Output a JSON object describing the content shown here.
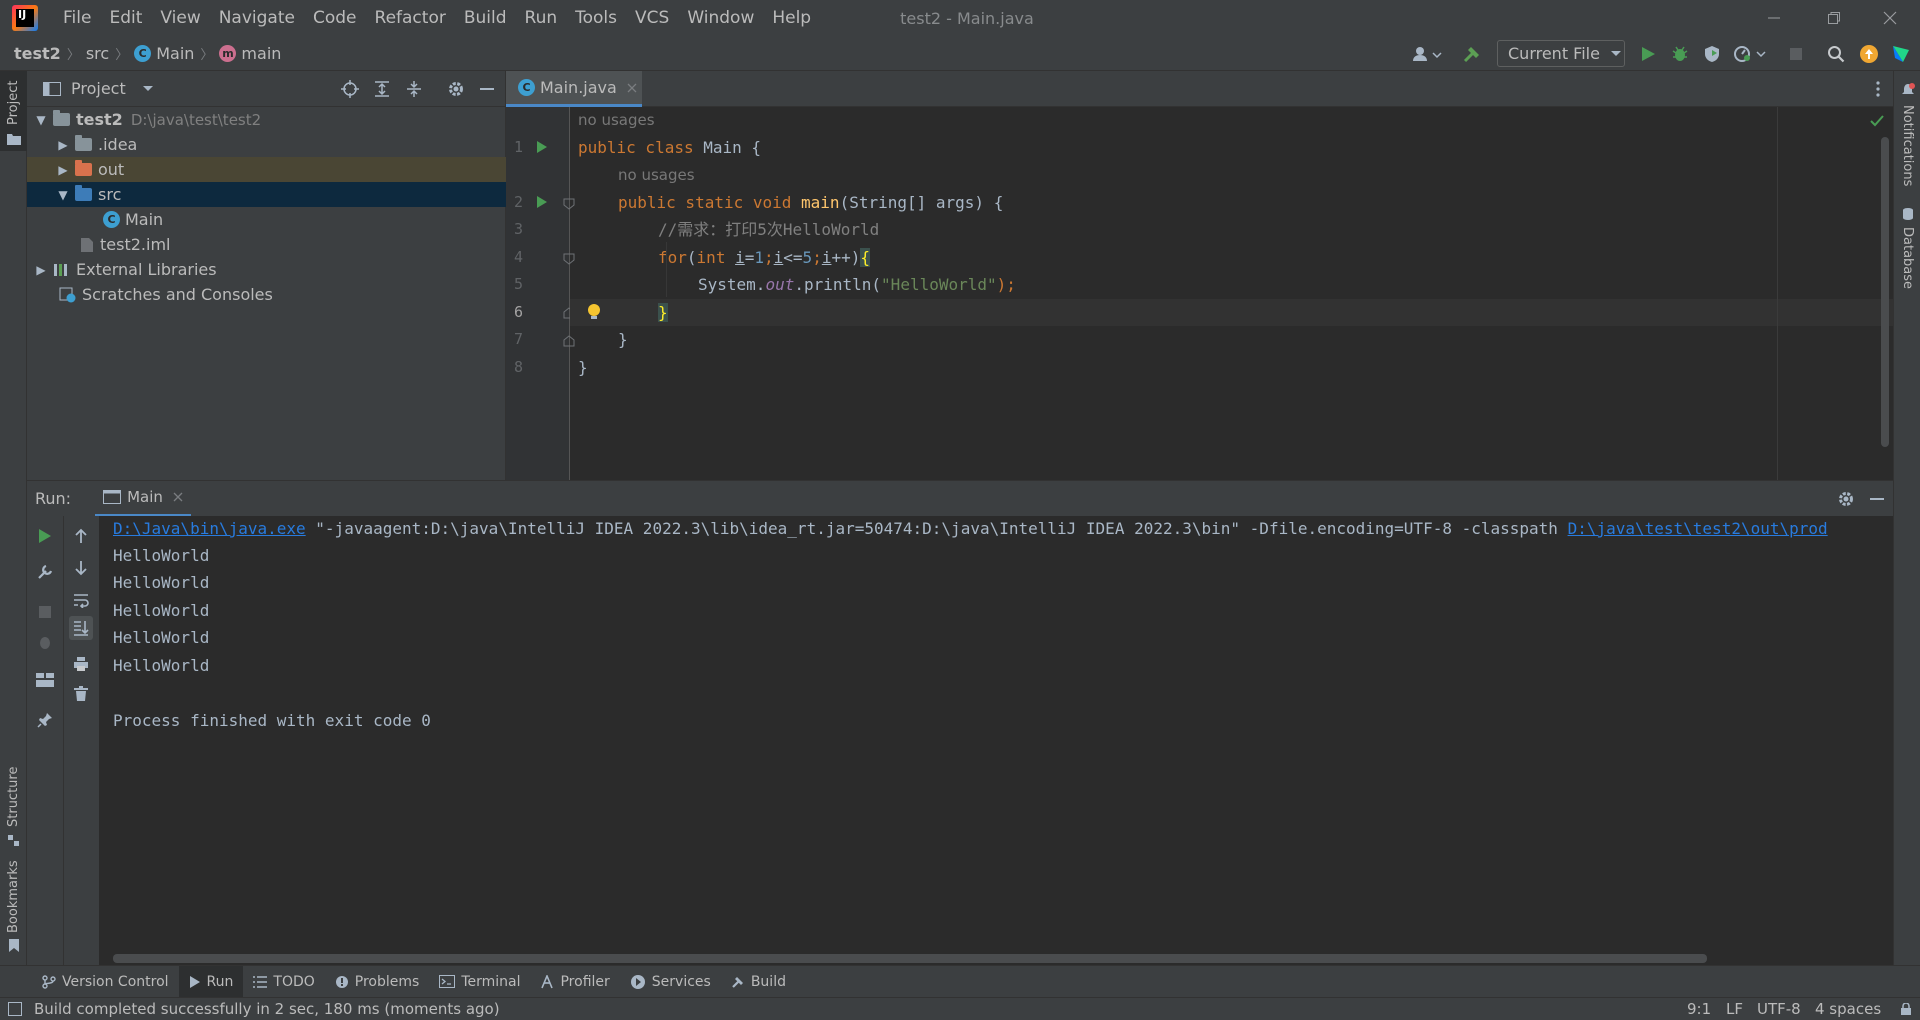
{
  "window": {
    "title": "test2 - Main.java",
    "menu": [
      "File",
      "Edit",
      "View",
      "Navigate",
      "Code",
      "Refactor",
      "Build",
      "Run",
      "Tools",
      "VCS",
      "Window",
      "Help"
    ]
  },
  "navbar": {
    "breadcrumb": [
      "test2",
      "src",
      "Main",
      "main"
    ],
    "run_config": "Current File"
  },
  "project": {
    "title": "Project",
    "tree": [
      {
        "label": "test2",
        "path": "D:\\java\\test\\test2"
      },
      {
        "label": ".idea"
      },
      {
        "label": "out"
      },
      {
        "label": "src"
      },
      {
        "label": "Main"
      },
      {
        "label": "test2.iml"
      },
      {
        "label": "External Libraries"
      },
      {
        "label": "Scratches and Consoles"
      }
    ]
  },
  "editor": {
    "tab": "Main.java",
    "hint": "no usages",
    "line_numbers": [
      "1",
      "2",
      "3",
      "4",
      "5",
      "6",
      "7",
      "8"
    ],
    "code": {
      "l1_kw": "public class ",
      "l1_name": "Main {",
      "l2_kw": "public static void ",
      "l2_fn": "main",
      "l2_rest": "(String[] args) {",
      "l3": "//需求：打印5次HelloWorld",
      "l4_for": "for",
      "l4_p1": "(",
      "l4_int": "int ",
      "l4_i1": "i",
      "l4_eq": "=",
      "l4_n1": "1",
      "l4_sc1": ";",
      "l4_i2": "i",
      "l4_le": "<=",
      "l4_n2": "5",
      "l4_sc2": ";",
      "l4_i3": "i",
      "l4_inc": "++)",
      "l4_brace": "{",
      "l5_sys": "System.",
      "l5_out": "out",
      "l5_print": ".println(",
      "l5_str": "\"HelloWorld\"",
      "l5_end": ");",
      "l6": "}",
      "l7": "}",
      "l8": "}"
    }
  },
  "run": {
    "label": "Run:",
    "tab": "Main",
    "cmd_link1": "D:\\Java\\bin\\java.exe",
    "cmd_mid": " \"-javaagent:D:\\java\\IntelliJ IDEA 2022.3\\lib\\idea_rt.jar=50474:D:\\java\\IntelliJ IDEA 2022.3\\bin\" -Dfile.encoding=UTF-8 -classpath ",
    "cmd_link2": "D:\\java\\test\\test2\\out\\prod",
    "output": [
      "HelloWorld",
      "HelloWorld",
      "HelloWorld",
      "HelloWorld",
      "HelloWorld"
    ],
    "finished": "Process finished with exit code 0"
  },
  "bottom_tabs": [
    "Version Control",
    "Run",
    "TODO",
    "Problems",
    "Terminal",
    "Profiler",
    "Services",
    "Build"
  ],
  "side_left": [
    "Project",
    "Structure",
    "Bookmarks"
  ],
  "side_right": [
    "Notifications",
    "Database"
  ],
  "status": {
    "message": "Build completed successfully in 2 sec, 180 ms (moments ago)",
    "position": "9:1",
    "line_sep": "LF",
    "encoding": "UTF-8",
    "indent": "4 spaces"
  },
  "colors": {
    "accent": "#4a88c7",
    "keyword": "#cc7832",
    "function": "#ffc66d",
    "string": "#6a8759",
    "run_green": "#499c54"
  }
}
